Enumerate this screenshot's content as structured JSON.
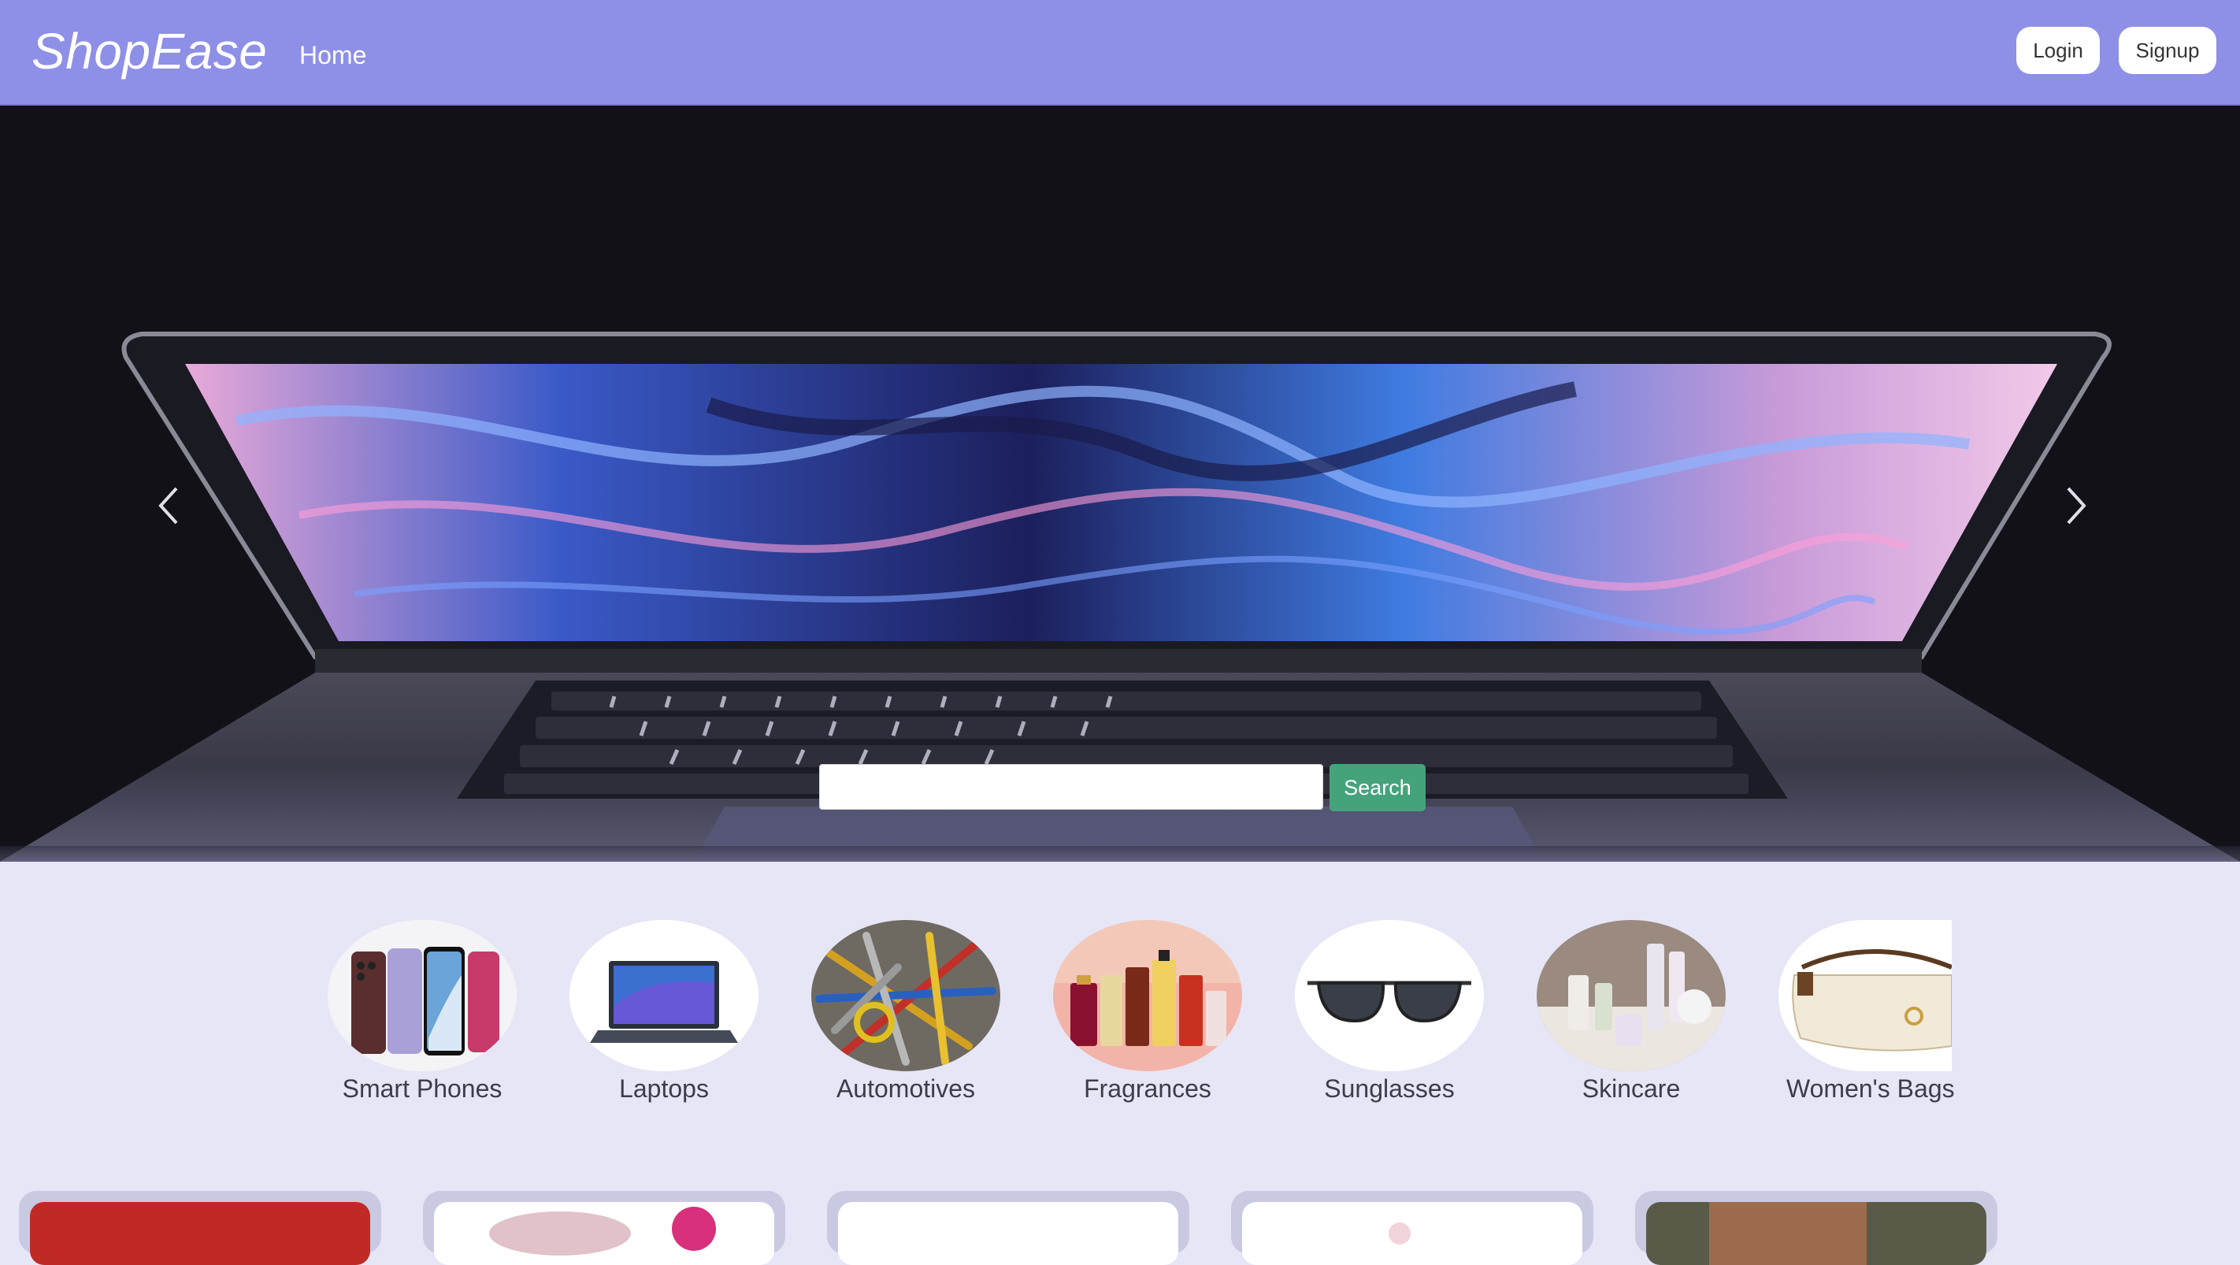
{
  "navbar": {
    "brand": "ShopEase",
    "home_label": "Home",
    "login_label": "Login",
    "signup_label": "Signup",
    "background": "#8e8fe6"
  },
  "hero": {
    "search": {
      "placeholder": "",
      "value": "",
      "button_label": "Search"
    },
    "prev_icon": "chevron-left-icon",
    "next_icon": "chevron-right-icon"
  },
  "categories": [
    {
      "label": "Smart Phones"
    },
    {
      "label": "Laptops"
    },
    {
      "label": "Automotives"
    },
    {
      "label": "Fragrances"
    },
    {
      "label": "Sunglasses"
    },
    {
      "label": "Skincare"
    },
    {
      "label": "Women's Bags"
    }
  ],
  "colors": {
    "accent_button": "#45a37c",
    "page_background": "#e6e6f7",
    "card_frame": "#c9cae2"
  }
}
